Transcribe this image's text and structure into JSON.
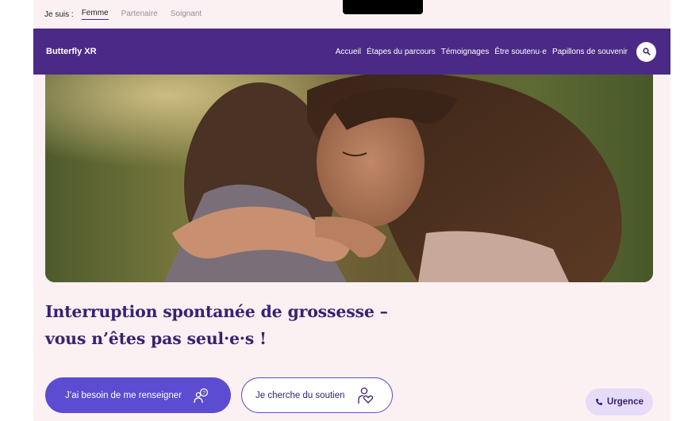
{
  "persona_bar": {
    "label": "Je suis :",
    "options": [
      "Femme",
      "Partenaire",
      "Soignant"
    ],
    "active": "Femme"
  },
  "nav": {
    "brand": "Butterfly XR",
    "items": [
      "Accueil",
      "Étapes du parcours",
      "Témoignages",
      "Être soutenu·e",
      "Papillons de souvenir"
    ],
    "search_icon": "search-icon"
  },
  "hero": {
    "image": "two people embracing outdoors"
  },
  "headline": {
    "line1": "Interruption spontanée de grossesse –",
    "line2": "vous n’êtes pas seul·e·s !"
  },
  "actions": {
    "inform_label": "J’ai besoin de me renseigner",
    "inform_icon": "question-people-icon",
    "support_label": "Je cherche du soutien",
    "support_icon": "heart-person-icon",
    "urgent_label": "Urgence",
    "urgent_icon": "phone-icon"
  },
  "colors": {
    "brand_purple": "#4a2a86",
    "button_blue": "#5b4cd1",
    "background": "#fbf1f3",
    "urgent_bg": "#e7dcf7"
  }
}
